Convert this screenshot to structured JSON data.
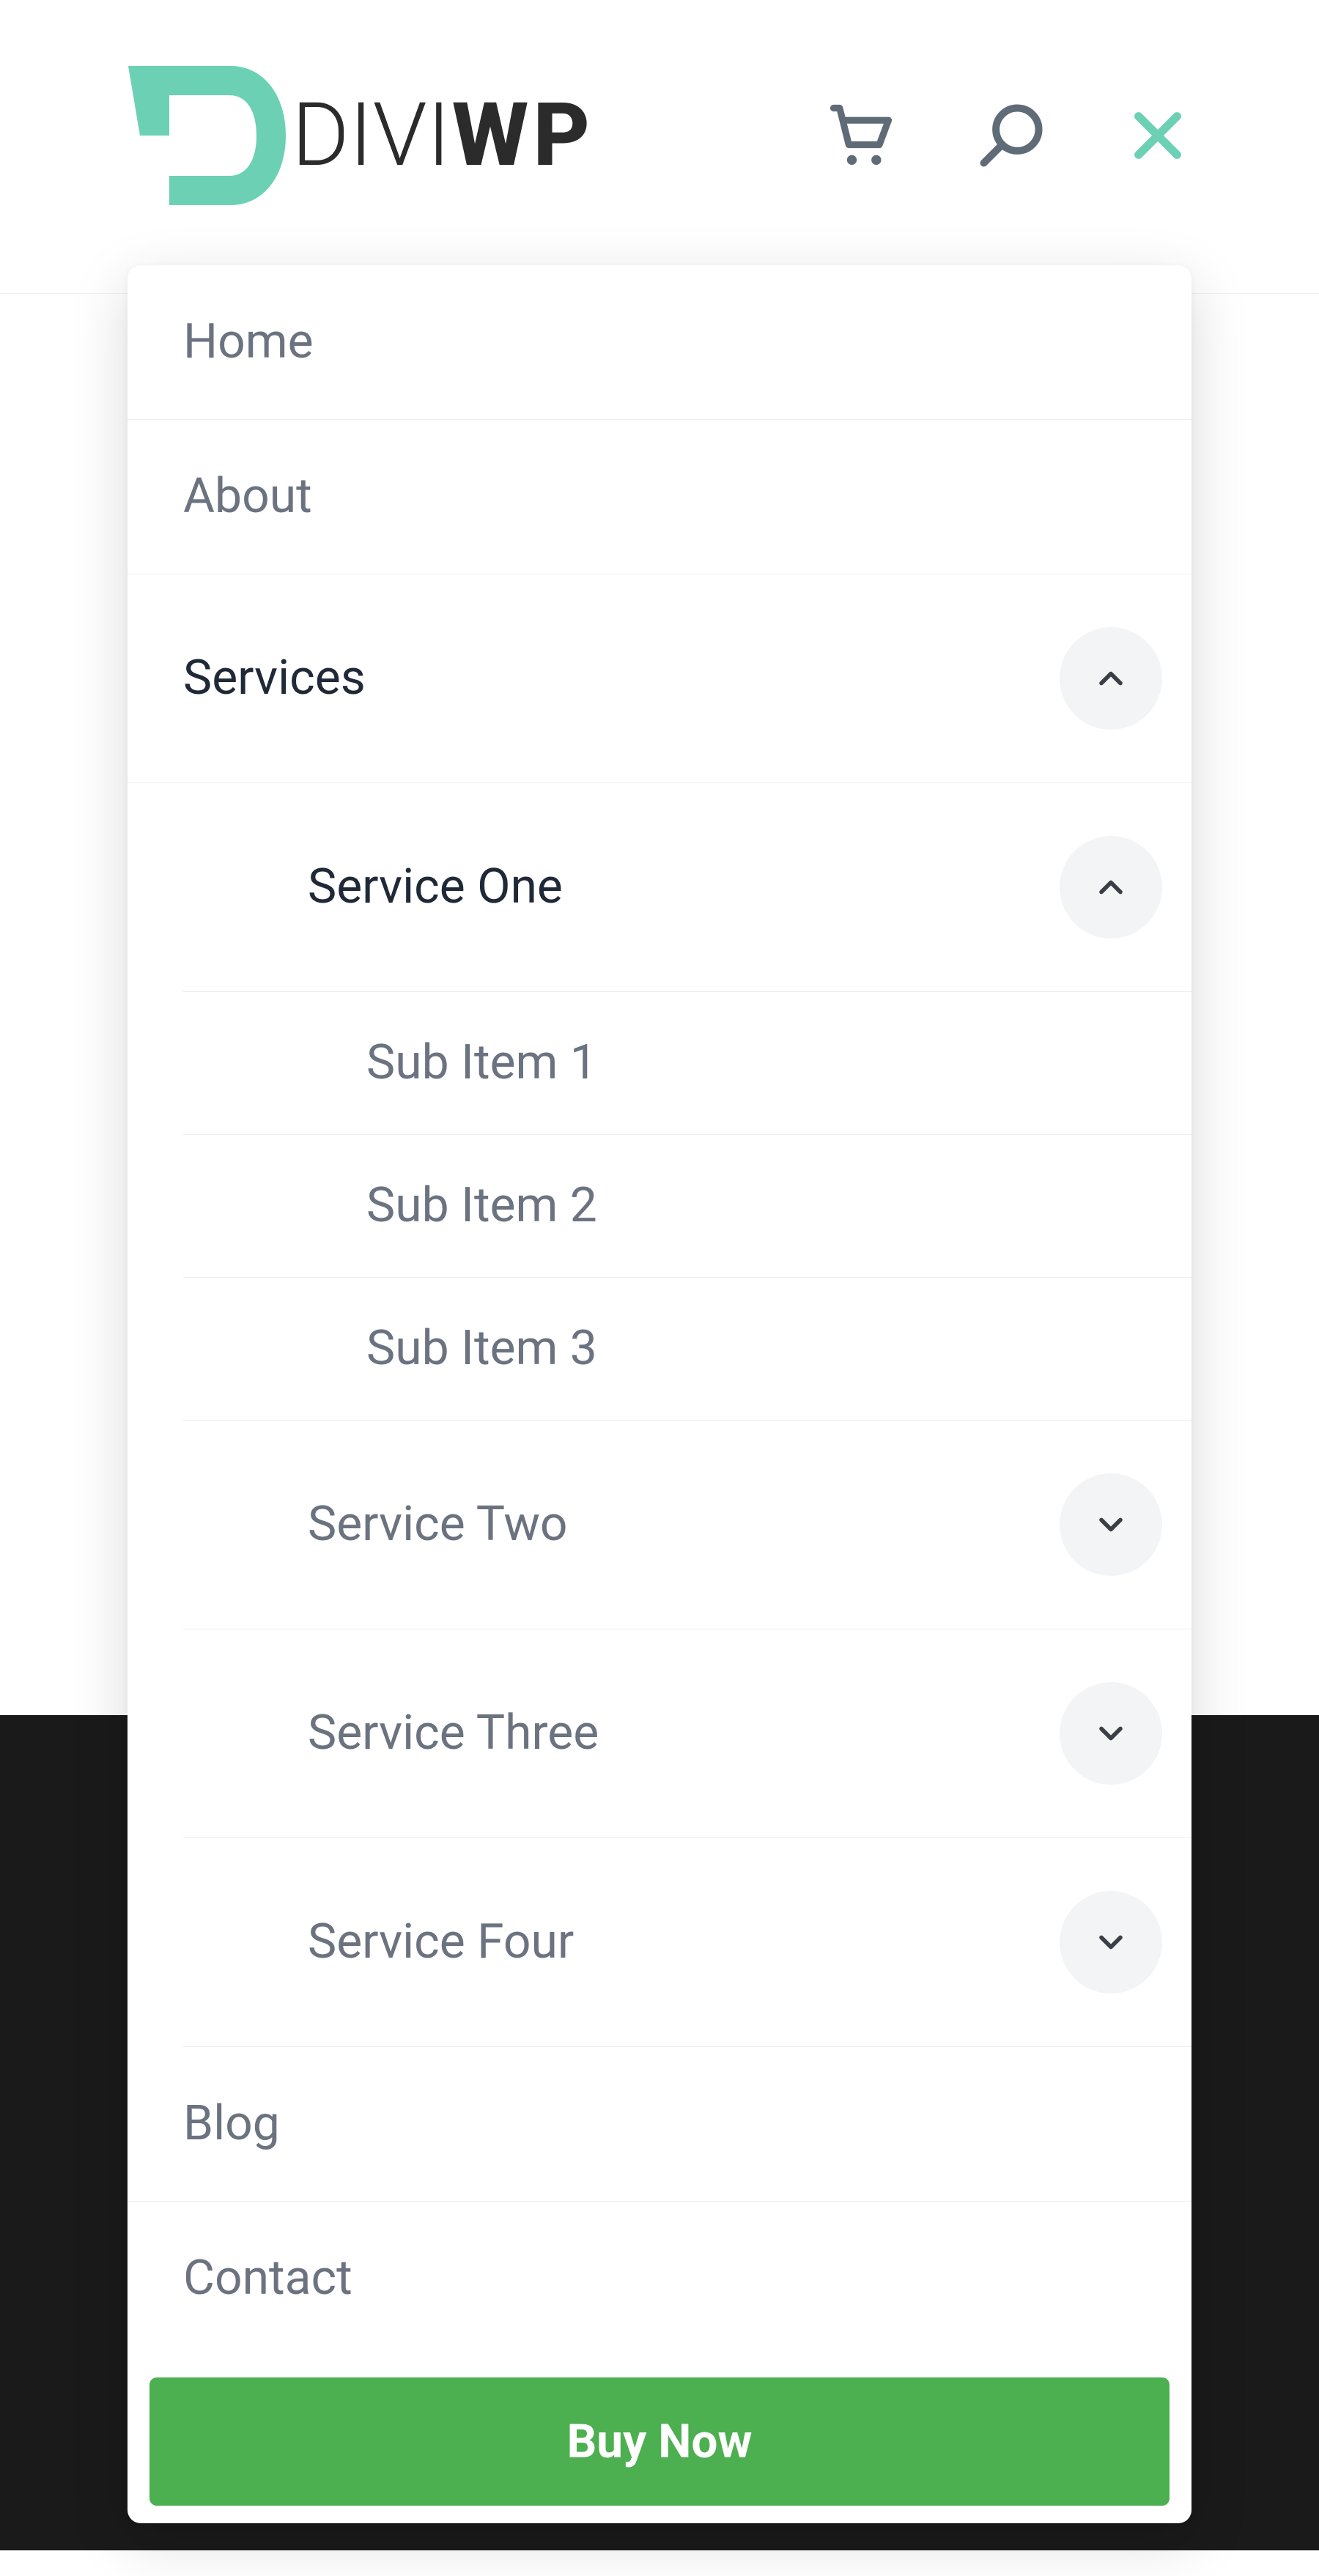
{
  "brand": {
    "logo_text_light": "DIVI",
    "logo_text_bold": "WP"
  },
  "colors": {
    "accent_teal": "#6cd1b4",
    "button_green": "#4caf50",
    "close_x": "#6cd1b4",
    "icon_gray": "#5f6b76"
  },
  "menu": {
    "items": [
      {
        "label": "Home"
      },
      {
        "label": "About"
      },
      {
        "label": "Services",
        "active": true,
        "expanded": true,
        "children": [
          {
            "label": "Service One",
            "active": true,
            "expanded": true,
            "children": [
              {
                "label": "Sub Item 1"
              },
              {
                "label": "Sub Item 2"
              },
              {
                "label": "Sub Item 3"
              }
            ]
          },
          {
            "label": "Service Two",
            "expanded": false
          },
          {
            "label": "Service Three",
            "expanded": false
          },
          {
            "label": "Service Four",
            "expanded": false
          }
        ]
      },
      {
        "label": "Blog"
      },
      {
        "label": "Contact"
      }
    ],
    "cta_label": "Buy Now"
  }
}
